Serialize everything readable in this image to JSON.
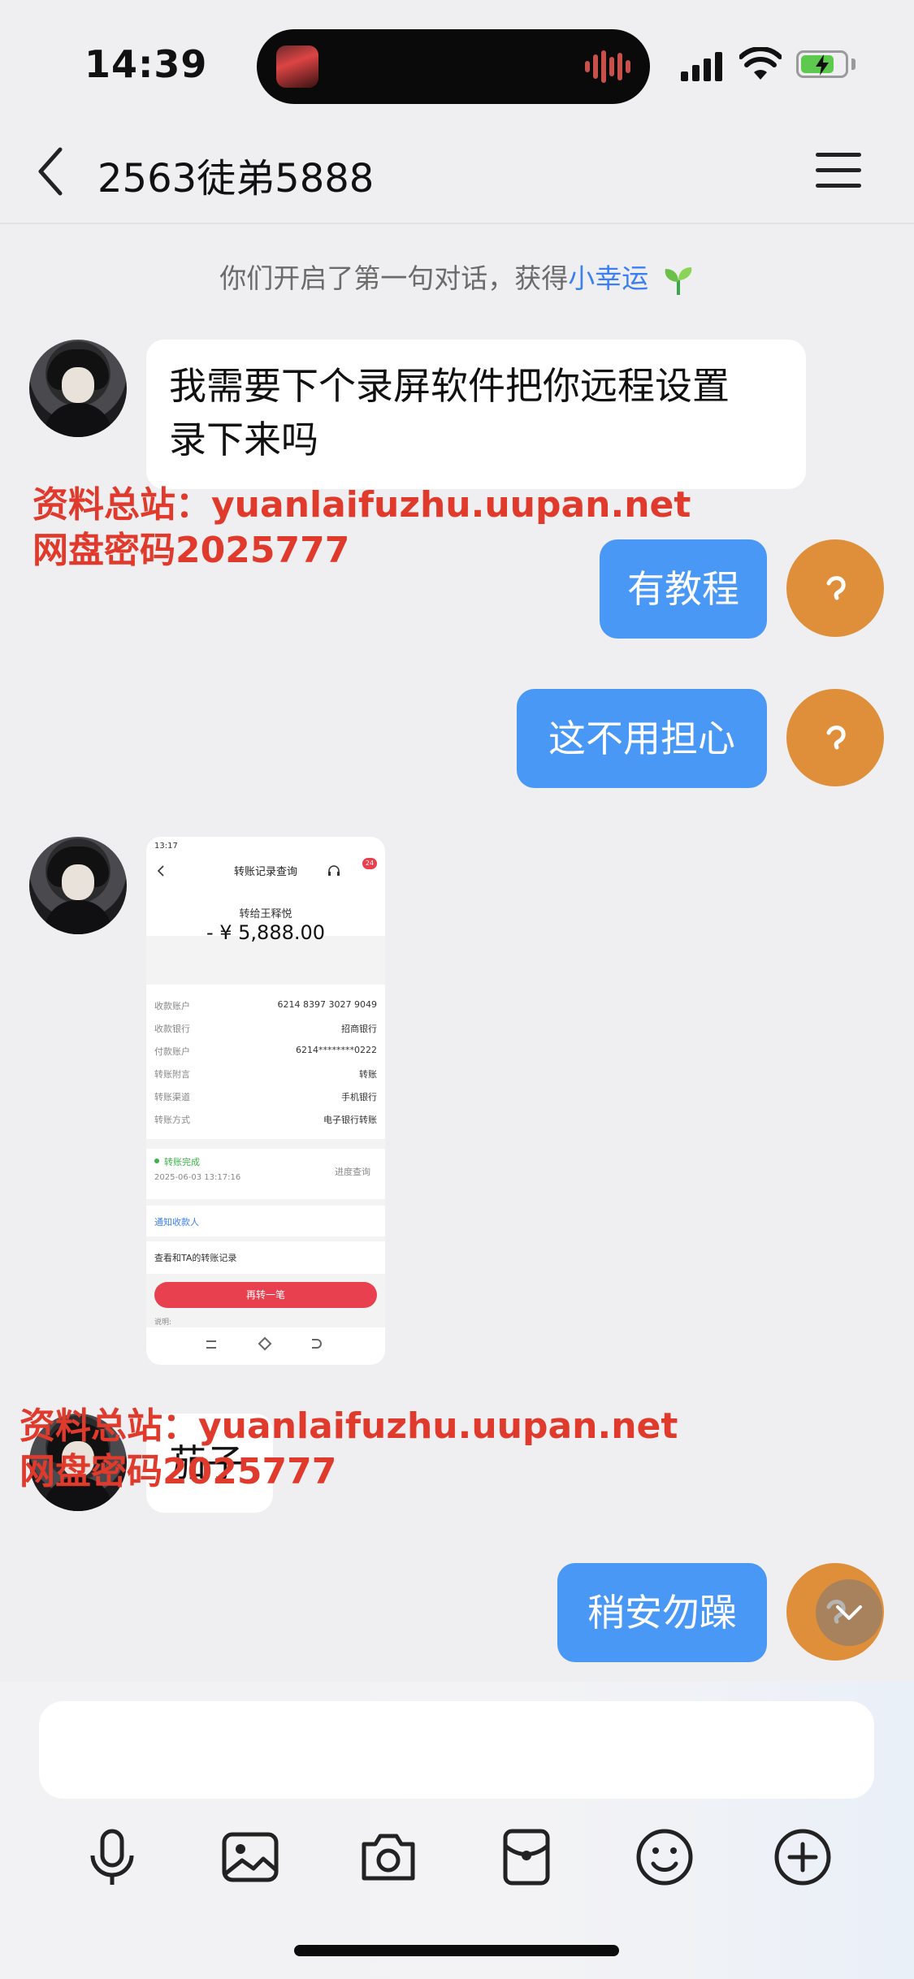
{
  "status": {
    "time": "14:39"
  },
  "nav": {
    "title": "2563徒弟5888",
    "back": "back",
    "menu": "more"
  },
  "system_tip": {
    "prefix": "你们开启了第一句对话，获得",
    "highlight": "小幸运"
  },
  "messages": [
    {
      "side": "left",
      "line1": "我需要下个录屏软件把你远程设置",
      "line2": "录下来吗"
    },
    {
      "side": "right",
      "text": "有教程"
    },
    {
      "side": "right",
      "text": "这不用担心"
    },
    {
      "side": "left",
      "type": "image"
    },
    {
      "side": "left",
      "text": "茄子"
    },
    {
      "side": "right",
      "text": "稍安勿躁"
    }
  ],
  "watermark": {
    "line1_label": "资料总站：",
    "line1_url": "yuanlaifuzhu.uupan.net",
    "line2_label": "网盘密码",
    "line2_code": "2025777"
  },
  "transfer_screenshot": {
    "status_time": "13:17",
    "title": "转账记录查询",
    "badge": "24",
    "payee_label": "转给王释悦",
    "amount": "- ¥ 5,888.00",
    "rows": [
      {
        "label": "收款账户",
        "value": "6214 8397 3027 9049"
      },
      {
        "label": "收款银行",
        "value": "招商银行"
      },
      {
        "label": "付款账户",
        "value": "6214********0222"
      },
      {
        "label": "转账附言",
        "value": "转账"
      },
      {
        "label": "转账渠道",
        "value": "手机银行"
      },
      {
        "label": "转账方式",
        "value": "电子银行转账"
      }
    ],
    "status": "转账完成",
    "status_time_full": "2025-06-03 13:17:16",
    "progress_link": "进度查询",
    "notify": "通知收款人",
    "history": "查看和TA的转账记录",
    "again_button": "再转一笔",
    "note": "说明:"
  },
  "toolbar": {
    "icons": [
      "microphone-icon",
      "image-icon",
      "camera-icon",
      "red-packet-icon",
      "emoji-icon",
      "plus-icon"
    ]
  },
  "colors": {
    "bubble_out": "#4a98f5",
    "bubble_in": "#ffffff",
    "accent_link": "#3c7ff2",
    "watermark": "#e03a2c",
    "avatar_right": "#df8f3a"
  }
}
